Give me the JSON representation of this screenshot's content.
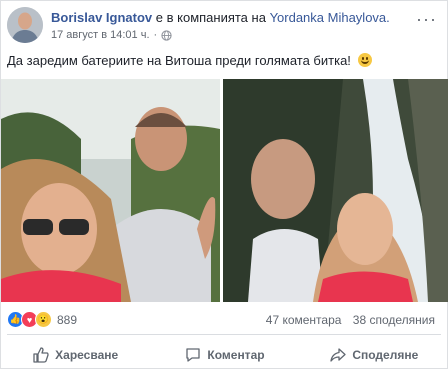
{
  "author": {
    "name": "Borislav Ignatov"
  },
  "tag_text": "е в компанията на",
  "tagged_name": "Yordanka Mihaylova.",
  "timestamp": "17 август в 14:01 ч.",
  "privacy_icon": "globe-icon",
  "post_text": "Да заредим батериите на Витоша преди голямата битка!",
  "post_emoji": "smile-emoji",
  "photos": [
    {
      "name": "photo-selfie-1"
    },
    {
      "name": "photo-selfie-waterfall"
    }
  ],
  "reactions": {
    "icons": [
      "like-icon",
      "love-icon",
      "wow-icon"
    ],
    "count": "889"
  },
  "stats": {
    "comments": "47 коментара",
    "shares": "38 споделяния"
  },
  "actions": [
    {
      "icon": "thumbs-up-icon",
      "label": "Харесване"
    },
    {
      "icon": "comment-icon",
      "label": "Коментар"
    },
    {
      "icon": "share-icon",
      "label": "Споделяне"
    }
  ],
  "colors": {
    "link": "#385898",
    "like": "#2078f4",
    "love": "#f33e58",
    "wow": "#f7c843",
    "muted": "#616770"
  }
}
